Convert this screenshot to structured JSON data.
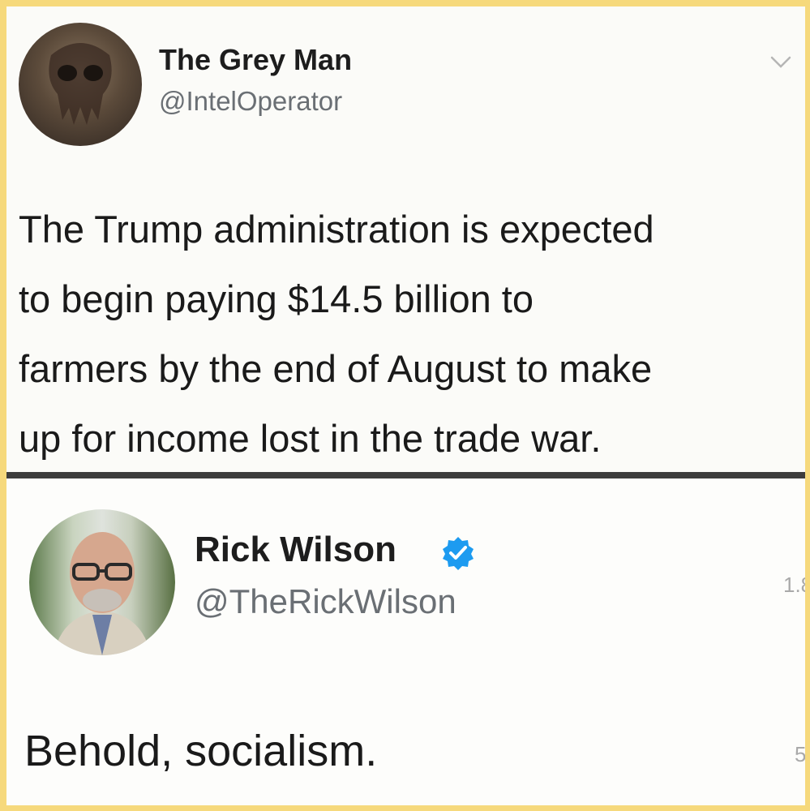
{
  "tweets": [
    {
      "author": "The Grey Man",
      "handle": "@IntelOperator",
      "text_lines": [
        "The Trump administration is expected",
        "to begin paying $14.5 billion to",
        "farmers by the end of August to make",
        "up for income lost in the trade war."
      ]
    },
    {
      "author": "Rick Wilson",
      "handle": "@TheRickWilson",
      "verified": true,
      "text": "Behold, socialism."
    }
  ],
  "edge_fragments": [
    "1.8",
    "5"
  ],
  "icons": {
    "menu": "chevron-down-icon",
    "verified": "verified-badge-icon"
  },
  "colors": {
    "background": "#f6d97c",
    "card": "#fbfbf8",
    "divider": "#3d3d3d",
    "verified": "#1d9bf0"
  }
}
